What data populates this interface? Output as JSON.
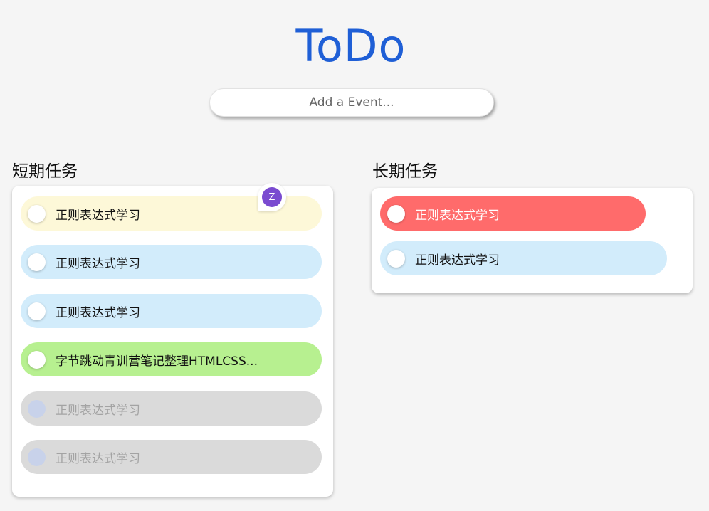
{
  "header": {
    "title": "ToDo",
    "add_placeholder": "Add a Event..."
  },
  "short_term": {
    "title": "短期任务",
    "avatar_letter": "Z",
    "tasks": [
      {
        "label": "正则表达式学习",
        "color": "#fdf8d8",
        "done": false
      },
      {
        "label": "正则表达式学习",
        "color": "#d2ecfb",
        "done": false
      },
      {
        "label": "正则表达式学习",
        "color": "#d2ecfb",
        "done": false
      },
      {
        "label": "字节跳动青训营笔记整理HTMLCSS...",
        "color": "#b7f090",
        "done": false
      },
      {
        "label": "正则表达式学习",
        "color": "#dadada",
        "done": true
      },
      {
        "label": "正则表达式学习",
        "color": "#dadada",
        "done": true
      }
    ]
  },
  "long_term": {
    "title": "长期任务",
    "tasks": [
      {
        "label": "正则表达式学习",
        "color": "#ff6b6b",
        "done": false
      },
      {
        "label": "正则表达式学习",
        "color": "#d2ecfb",
        "done": false
      }
    ]
  },
  "colors": {
    "title": "#1f5fd6",
    "background": "#f5f5f5",
    "avatar": "#7a4bd0"
  }
}
